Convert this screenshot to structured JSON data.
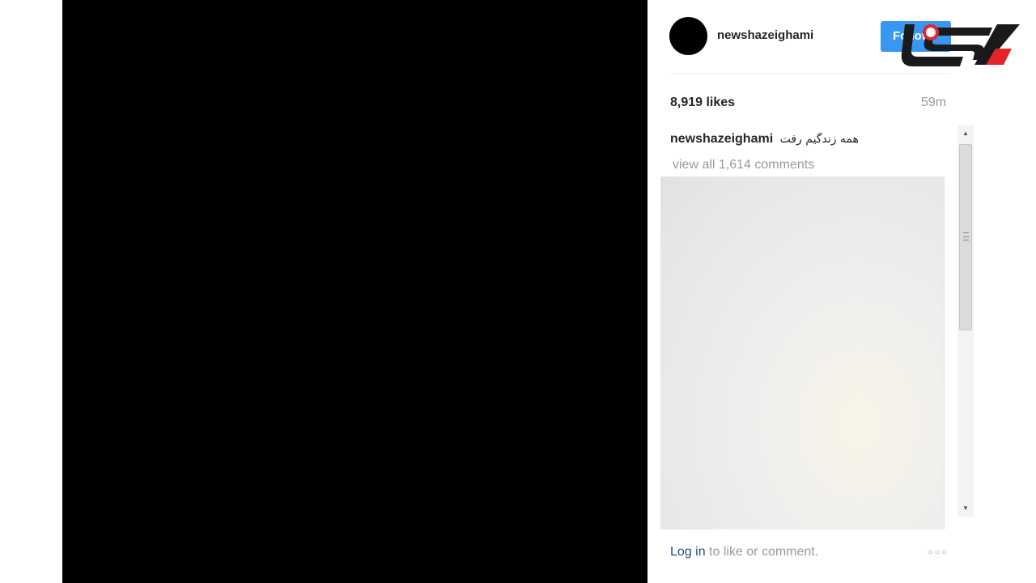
{
  "post": {
    "username": "newshazeighami",
    "follow_label": "Follow",
    "likes": "8,919 likes",
    "time_ago": "59m",
    "caption": {
      "user": "newshazeighami",
      "text": "همه زندگیم رفت"
    },
    "view_comments": "view all 1,614 comments"
  },
  "footer": {
    "login_link": "Log in",
    "login_suffix": " to like or comment."
  },
  "icons": {
    "more": "more-options-icon",
    "scroll_up": "scroll-up-icon",
    "scroll_down": "scroll-down-icon"
  },
  "colors": {
    "follow_button": "#3897f0",
    "logo_red": "#e3242b",
    "logo_dark": "#1a1a1a",
    "link": "#1f4f82",
    "muted": "#999999"
  }
}
